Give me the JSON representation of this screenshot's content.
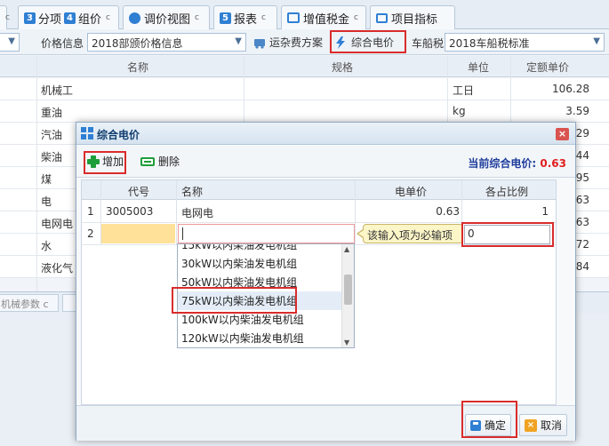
{
  "tabs": [
    {
      "num": "3",
      "label": "分项"
    },
    {
      "num": "4",
      "label": "组价"
    },
    {
      "label": "调价视图"
    },
    {
      "num": "5",
      "label": "报表"
    },
    {
      "label": "增值税金"
    },
    {
      "label": "项目指标"
    }
  ],
  "toolbar": {
    "price_info_label": "价格信息",
    "price_info_value": "2018部颁价格信息",
    "freight_label": "运杂费方案",
    "electricity_label": "综合电价",
    "vessel_tax_label": "车船税",
    "vessel_tax_value": "2018车船税标准"
  },
  "main_grid": {
    "headers": {
      "name": "名称",
      "spec": "规格",
      "unit": "单位",
      "price": "定额单价"
    },
    "rows": [
      {
        "name": "机械工",
        "unit": "工日",
        "price": "106.28"
      },
      {
        "name": "重油",
        "unit": "kg",
        "price": "3.59"
      },
      {
        "name": "汽油",
        "unit": "",
        "price": "29"
      },
      {
        "name": "柴油",
        "unit": "",
        "price": "44"
      },
      {
        "name": "煤",
        "unit": "",
        "price": "95"
      },
      {
        "name": "电",
        "unit": "",
        "price": "63"
      },
      {
        "name": "电网电",
        "unit": "",
        "price": "63"
      },
      {
        "name": "水",
        "unit": "",
        "price": "72"
      },
      {
        "name": "液化气",
        "unit": "",
        "price": "84"
      }
    ],
    "bottom_tabs": [
      "机械参数"
    ]
  },
  "dialog": {
    "title": "综合电价",
    "add_label": "增加",
    "delete_label": "删除",
    "current_price_label": "当前综合电价:",
    "current_price_value": "0.63",
    "headers": {
      "code": "代号",
      "name": "名称",
      "price": "电单价",
      "ratio": "各占比例"
    },
    "rows": [
      {
        "idx": "1",
        "code": "3005003",
        "name": "电网电",
        "price": "0.63",
        "ratio": "1"
      }
    ],
    "edit_row": {
      "idx": "2",
      "ratio_value": "0"
    },
    "tooltip": "该输入项为必输项",
    "dropdown_items": [
      "15kW以内柴油发电机组",
      "30kW以内柴油发电机组",
      "50kW以内柴油发电机组",
      "75kW以内柴油发电机组",
      "100kW以内柴油发电机组",
      "120kW以内柴油发电机组"
    ],
    "ok_label": "确定",
    "cancel_label": "取消"
  },
  "colors": {
    "accent": "#2f7fd3",
    "highlight": "#d92c2c",
    "price_value": "#e0201f",
    "edit_cell": "#ffe199"
  }
}
